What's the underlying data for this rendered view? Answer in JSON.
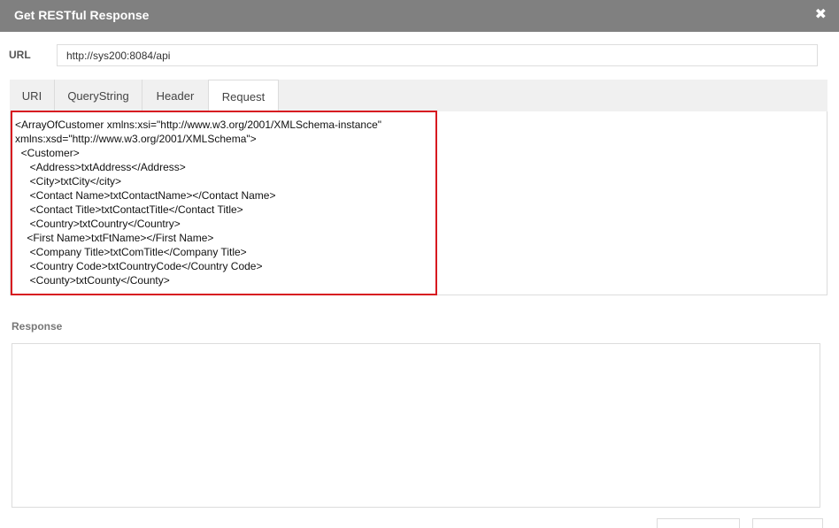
{
  "window": {
    "title": "Get RESTful Response",
    "close_glyph": "✖"
  },
  "url": {
    "label": "URL",
    "value": "http://sys200:8084/api"
  },
  "tabs": [
    {
      "label": "URI"
    },
    {
      "label": "QueryString"
    },
    {
      "label": "Header"
    },
    {
      "label": "Request"
    }
  ],
  "active_tab": "Request",
  "request": {
    "body": "<ArrayOfCustomer xmlns:xsi=\"http://www.w3.org/2001/XMLSchema-instance\"\nxmlns:xsd=\"http://www.w3.org/2001/XMLSchema\">\n  <Customer>\n     <Address>txtAddress</Address>\n     <City>txtCity</city>\n     <Contact Name>txtContactName></Contact Name>\n     <Contact Title>txtContactTitle</Contact Title>\n     <Country>txtCountry</Country>\n    <First Name>txtFtName></First Name>\n     <Company Title>txtComTitle</Company Title>\n     <Country Code>txtCountryCode</Country Code>\n     <County>txtCounty</County>"
  },
  "response": {
    "label": "Response",
    "value": ""
  },
  "colors": {
    "titlebar": "#808080",
    "highlight": "#d71920",
    "tabbar": "#f0f0f0"
  }
}
